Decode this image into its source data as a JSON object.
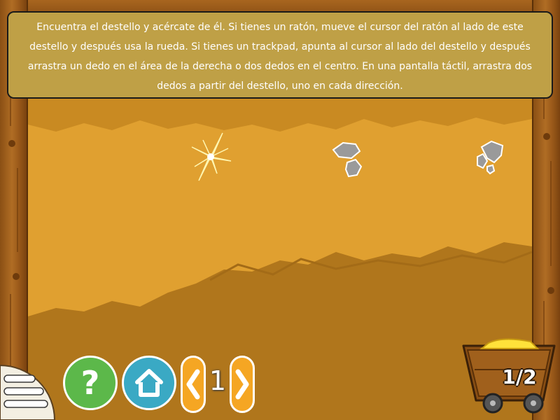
{
  "instructions": {
    "text": "Encuentra el destello y acércate de él. Si tienes un ratón, mueve el cursor del ratón al lado de este destello y después usa la rueda. Si tienes un trackpad, apunta al cursor al lado del destello y después arrastra un dedo en el área de la derecha o dos dedos en el centro. En una pantalla táctil, arrastra dos dedos a partir del destello, uno en cada dirección."
  },
  "controls": {
    "menu_icon": "hamburger-menu-icon",
    "help_label": "?",
    "home_icon": "home-icon",
    "prev_icon": "chevron-left-icon",
    "next_icon": "chevron-right-icon",
    "page_number": "1"
  },
  "progress": {
    "label": "1/2",
    "collected": 1,
    "total": 2,
    "icon": "mine-cart-gold-icon"
  },
  "colors": {
    "banner": "#bfa046",
    "help_button": "#5cb84a",
    "home_button": "#3aa9c4",
    "arrow_button": "#f5a623",
    "dirt_light": "#e0a030",
    "dirt_dark": "#b0761c",
    "wood": "#9b5a1a"
  }
}
